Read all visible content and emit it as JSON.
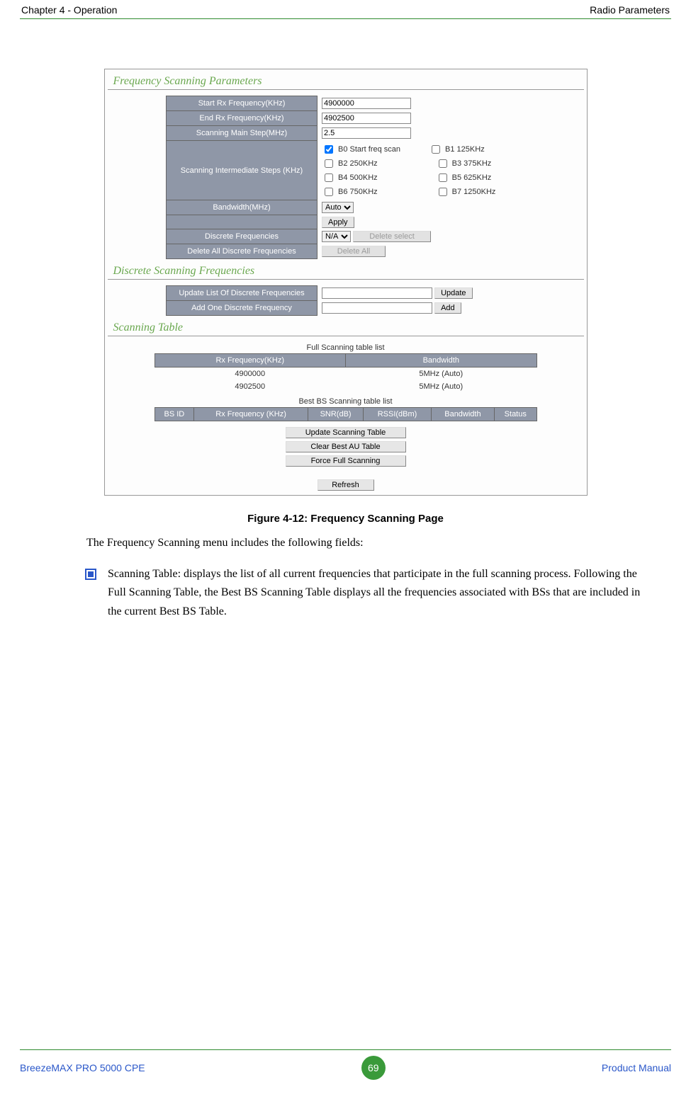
{
  "header": {
    "left": "Chapter 4 - Operation",
    "right": "Radio Parameters"
  },
  "sections": {
    "freq_scan_params": {
      "title": "Frequency Scanning Parameters",
      "rows": {
        "start_rx": {
          "label": "Start Rx Frequency(KHz)",
          "value": "4900000"
        },
        "end_rx": {
          "label": "End Rx Frequency(KHz)",
          "value": "4902500"
        },
        "main_step": {
          "label": "Scanning Main Step(MHz)",
          "value": "2.5"
        },
        "inter_steps": {
          "label": "Scanning Intermediate Steps (KHz)",
          "opts": {
            "b0": "B0 Start freq scan",
            "b1": "B1 125KHz",
            "b2": "B2 250KHz",
            "b3": "B3 375KHz",
            "b4": "B4 500KHz",
            "b5": "B5 625KHz",
            "b6": "B6 750KHz",
            "b7": "B7 1250KHz"
          }
        },
        "bandwidth": {
          "label": "Bandwidth(MHz)",
          "value": "Auto"
        },
        "apply": "Apply",
        "discrete": {
          "label": "Discrete Frequencies",
          "select": "N/A",
          "delete_select": "Delete select"
        },
        "delete_all": {
          "label": "Delete All Discrete Frequencies",
          "button": "Delete All"
        }
      }
    },
    "discrete_scan": {
      "title": "Discrete Scanning Frequencies",
      "update_list": {
        "label": "Update List Of Discrete Frequencies",
        "button": "Update"
      },
      "add_one": {
        "label": "Add One Discrete Frequency",
        "button": "Add"
      }
    },
    "scanning_table": {
      "title": "Scanning Table",
      "full_caption": "Full Scanning table list",
      "full_headers": [
        "Rx Frequency(KHz)",
        "Bandwidth"
      ],
      "full_rows": [
        {
          "freq": "4900000",
          "bw": "5MHz (Auto)"
        },
        {
          "freq": "4902500",
          "bw": "5MHz (Auto)"
        }
      ],
      "best_caption": "Best BS Scanning table list",
      "best_headers": [
        "BS ID",
        "Rx Frequency (KHz)",
        "SNR(dB)",
        "RSSI(dBm)",
        "Bandwidth",
        "Status"
      ],
      "buttons": {
        "update": "Update Scanning Table",
        "clear": "Clear Best AU Table",
        "force": "Force Full Scanning",
        "refresh": "Refresh"
      }
    }
  },
  "figure_caption": "Figure 4-12: Frequency Scanning Page",
  "intro_text": "The Frequency Scanning menu includes the following fields:",
  "bullet_text": "Scanning Table: displays the list of all current frequencies that participate in the full scanning process. Following the Full Scanning Table, the Best BS Scanning Table displays all the frequencies associated with BSs that are included in the current Best BS Table.",
  "footer": {
    "left": "BreezeMAX PRO 5000 CPE",
    "page": "69",
    "right": "Product Manual"
  }
}
